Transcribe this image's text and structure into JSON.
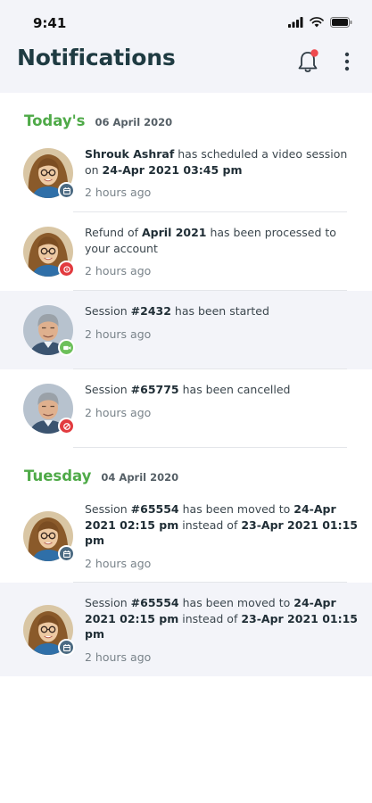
{
  "status": {
    "time": "9:41"
  },
  "header": {
    "title": "Notifications"
  },
  "sections": [
    {
      "day": "Today's",
      "date": "06 April 2020",
      "items": [
        {
          "avatar": "woman",
          "badge": "calendar",
          "highlight": false,
          "parts": [
            [
              "Shrouk Ashraf",
              true
            ],
            [
              " has scheduled a video session on ",
              false
            ],
            [
              "24-Apr 2021 03:45 pm",
              true
            ]
          ],
          "time": "2 hours ago"
        },
        {
          "avatar": "woman",
          "badge": "refund",
          "highlight": false,
          "parts": [
            [
              "Refund of ",
              false
            ],
            [
              "April 2021",
              true
            ],
            [
              " has been processed to your account",
              false
            ]
          ],
          "time": "2 hours ago"
        },
        {
          "avatar": "man",
          "badge": "video",
          "highlight": true,
          "parts": [
            [
              "Session ",
              false
            ],
            [
              "#2432",
              true
            ],
            [
              " has been started",
              false
            ]
          ],
          "time": "2 hours ago"
        },
        {
          "avatar": "man",
          "badge": "cancel",
          "highlight": false,
          "parts": [
            [
              "Session ",
              false
            ],
            [
              "#65775",
              true
            ],
            [
              " has been cancelled",
              false
            ]
          ],
          "time": "2 hours ago"
        }
      ]
    },
    {
      "day": "Tuesday",
      "date": "04 April 2020",
      "items": [
        {
          "avatar": "woman",
          "badge": "calendar",
          "highlight": false,
          "parts": [
            [
              "Session ",
              false
            ],
            [
              "#65554",
              true
            ],
            [
              " has been moved to ",
              false
            ],
            [
              "24-Apr 2021 02:15 pm",
              true
            ],
            [
              " instead of ",
              false
            ],
            [
              "23-Apr 2021 01:15 pm",
              true
            ]
          ],
          "time": "2 hours ago"
        },
        {
          "avatar": "woman",
          "badge": "calendar",
          "highlight": true,
          "parts": [
            [
              "Session ",
              false
            ],
            [
              "#65554",
              true
            ],
            [
              " has been moved to ",
              false
            ],
            [
              "24-Apr 2021 02:15 pm",
              true
            ],
            [
              " instead of ",
              false
            ],
            [
              "23-Apr 2021 01:15 pm",
              true
            ]
          ],
          "time": "2 hours ago"
        }
      ]
    }
  ],
  "colors": {
    "accent_green": "#4faa48",
    "title": "#1f3b42",
    "badge_calendar": "#4b6a82",
    "badge_red": "#e23b3f",
    "badge_video": "#6cc05a",
    "highlight_bg": "#f3f4f9",
    "bell_dot": "#ef4a4f"
  },
  "icons": {
    "bell": "bell-icon",
    "more": "more-vertical-icon",
    "calendar": "calendar-badge-icon",
    "refund": "refund-badge-icon",
    "video": "video-badge-icon",
    "cancel": "cancel-badge-icon"
  }
}
